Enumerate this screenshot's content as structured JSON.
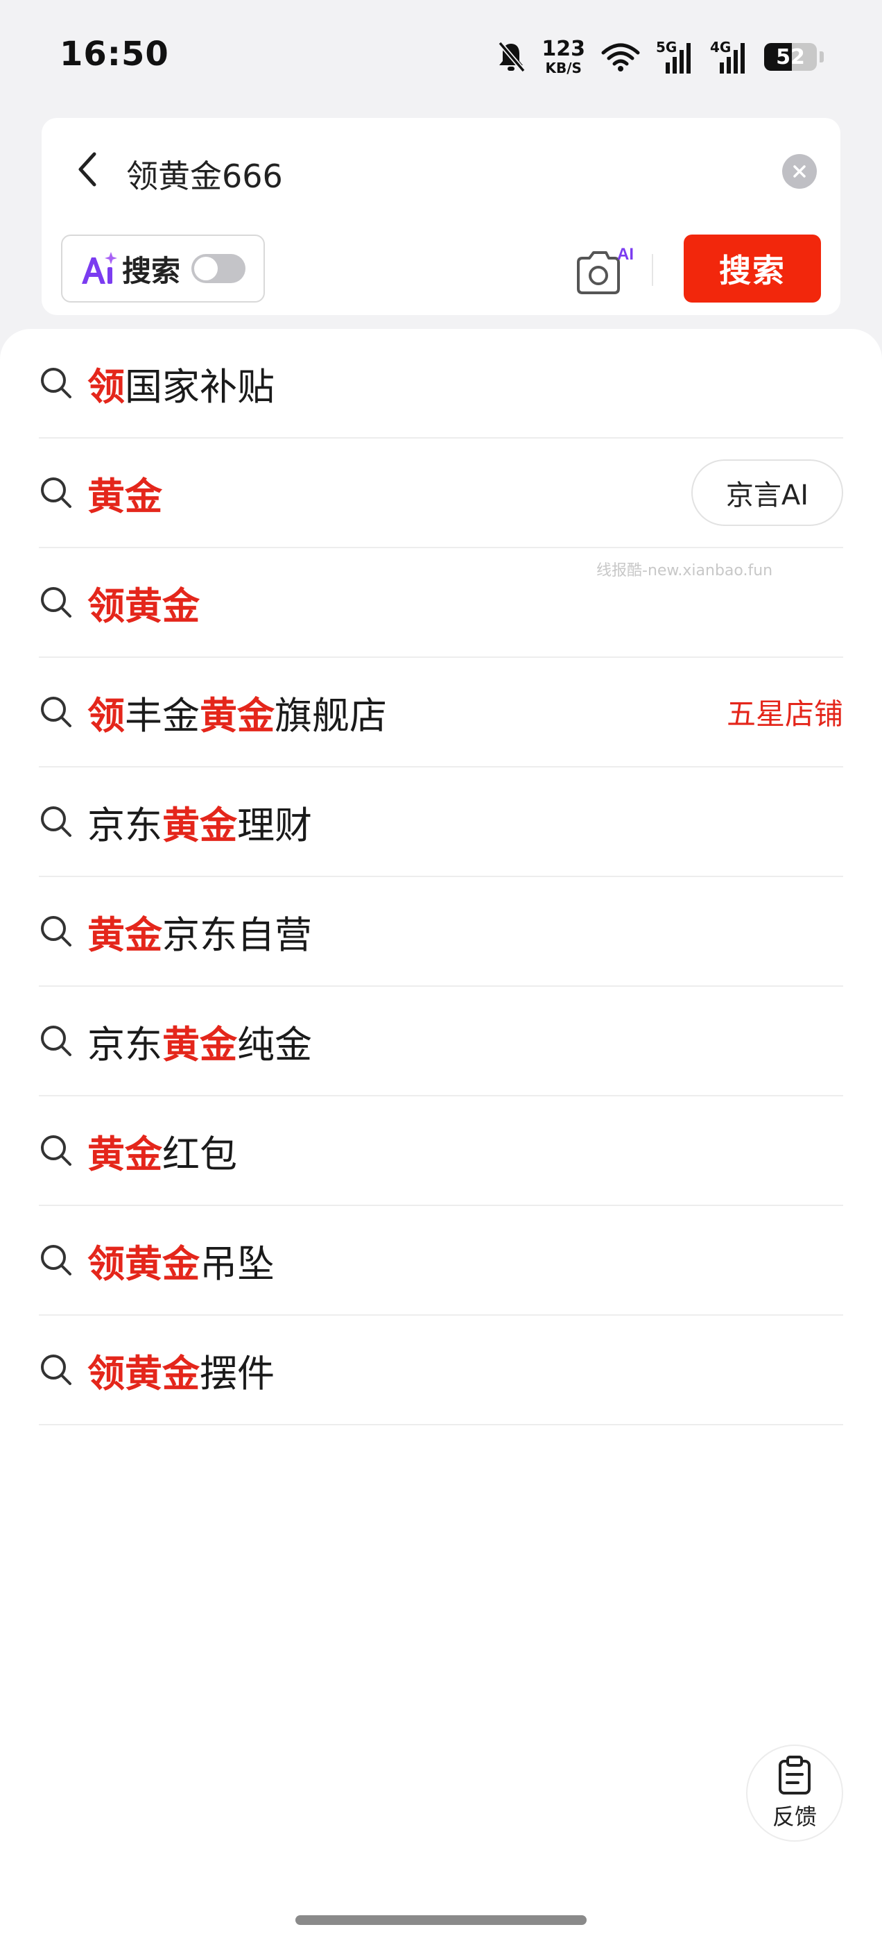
{
  "status_bar": {
    "time": "16:50",
    "net_speed_value": "123",
    "net_speed_unit": "KB/S",
    "signal_1_label": "5G",
    "signal_2_label": "4G",
    "battery_percent": 52
  },
  "search": {
    "query": "领黄金666",
    "ai_toggle_label": "搜索",
    "ai_toggle_on": false,
    "camera_badge": "AI",
    "search_button": "搜索"
  },
  "suggestions": [
    {
      "segments": [
        {
          "t": "领",
          "h": true
        },
        {
          "t": "国家补贴",
          "h": false
        }
      ]
    },
    {
      "segments": [
        {
          "t": "黄金",
          "h": true
        }
      ],
      "chip": "京言AI"
    },
    {
      "segments": [
        {
          "t": "领黄金",
          "h": true
        }
      ]
    },
    {
      "segments": [
        {
          "t": "领",
          "h": true
        },
        {
          "t": "丰金",
          "h": false
        },
        {
          "t": "黄金",
          "h": true
        },
        {
          "t": "旗舰店",
          "h": false
        }
      ],
      "tag": "五星店铺"
    },
    {
      "segments": [
        {
          "t": "京东",
          "h": false
        },
        {
          "t": "黄金",
          "h": true
        },
        {
          "t": "理财",
          "h": false
        }
      ]
    },
    {
      "segments": [
        {
          "t": "黄金",
          "h": true
        },
        {
          "t": "京东自营",
          "h": false
        }
      ]
    },
    {
      "segments": [
        {
          "t": "京东",
          "h": false
        },
        {
          "t": "黄金",
          "h": true
        },
        {
          "t": "纯金",
          "h": false
        }
      ]
    },
    {
      "segments": [
        {
          "t": "黄金",
          "h": true
        },
        {
          "t": "红包",
          "h": false
        }
      ]
    },
    {
      "segments": [
        {
          "t": "领黄金",
          "h": true
        },
        {
          "t": "吊坠",
          "h": false
        }
      ]
    },
    {
      "segments": [
        {
          "t": "领黄金",
          "h": true
        },
        {
          "t": "摆件",
          "h": false
        }
      ]
    }
  ],
  "watermark": "线报酷-new.xianbao.fun",
  "feedback": {
    "label": "反馈"
  },
  "colors": {
    "accent": "#f2270c",
    "highlight": "#e4261b",
    "background": "#f2f2f4",
    "ai_purple": "#7b3cf0"
  }
}
